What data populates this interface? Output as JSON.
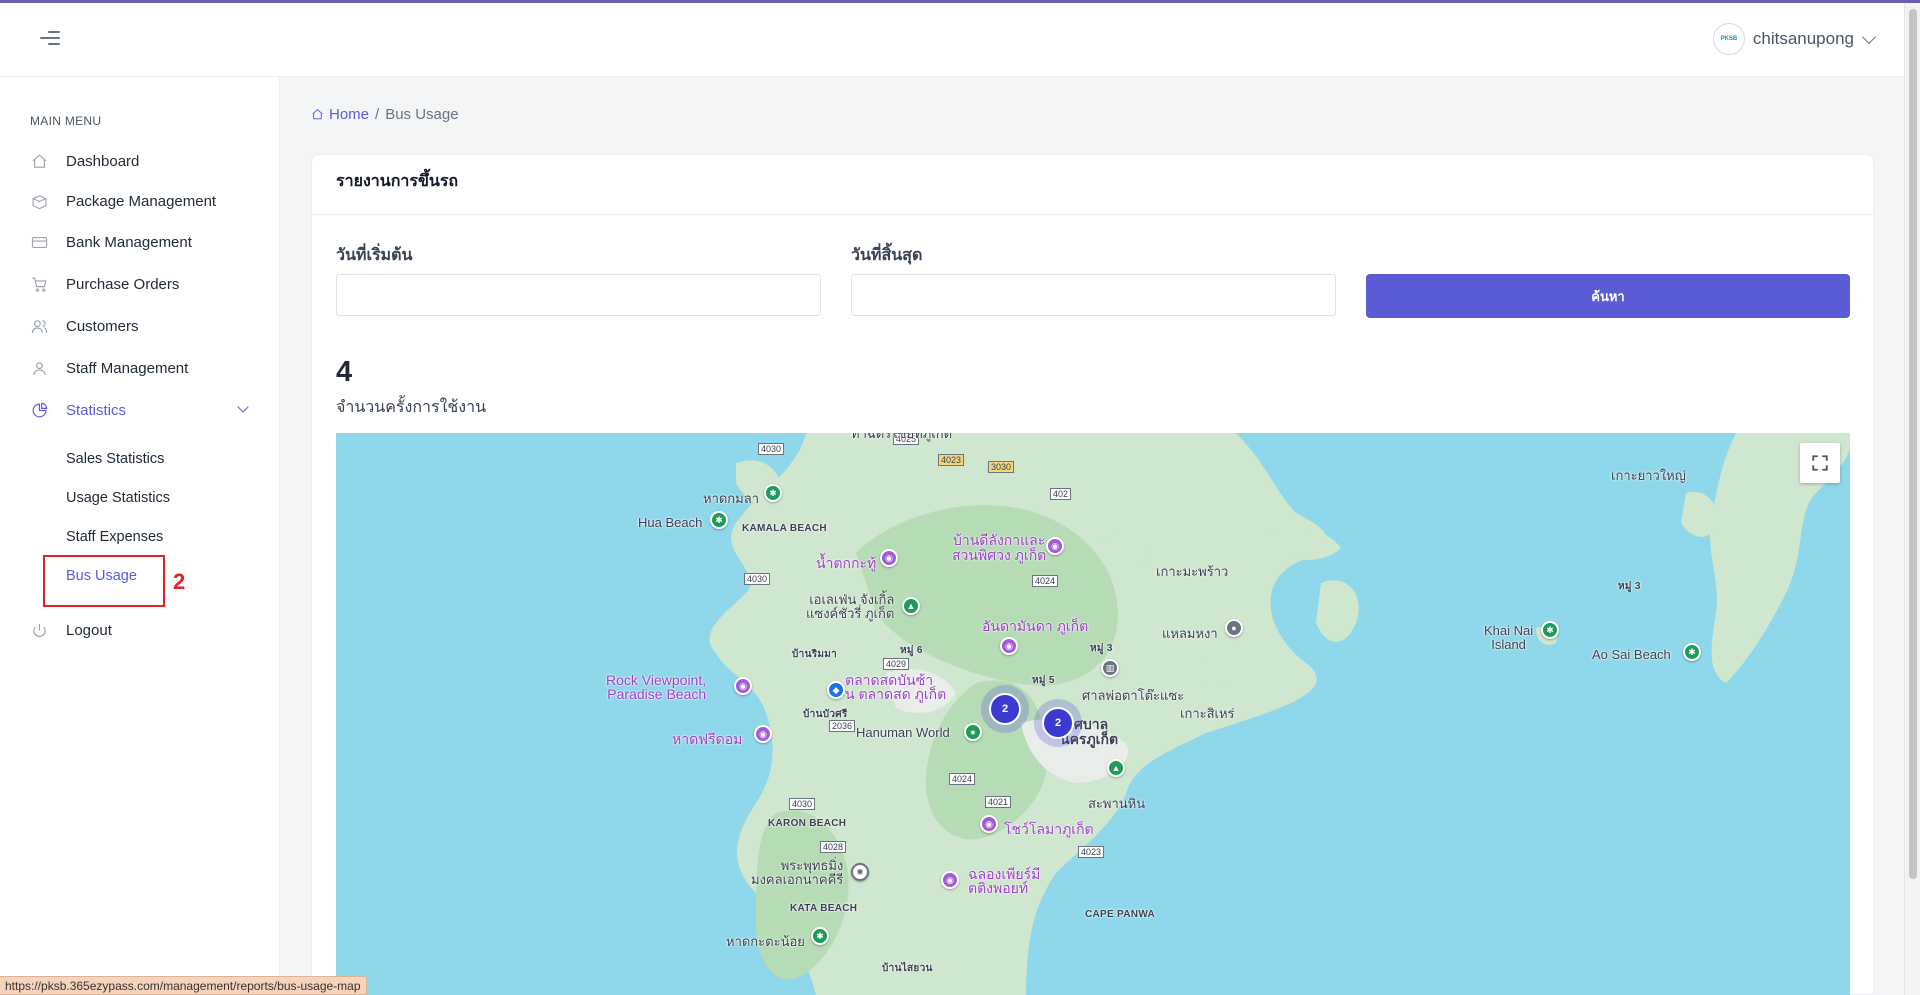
{
  "header": {
    "username": "chitsanupong",
    "avatar_text": "PKSB"
  },
  "sidebar": {
    "menu_title": "MAIN MENU",
    "items": [
      {
        "label": "Dashboard",
        "icon": "home-icon"
      },
      {
        "label": "Package Management",
        "icon": "package-icon"
      },
      {
        "label": "Bank Management",
        "icon": "credit-card-icon"
      },
      {
        "label": "Purchase Orders",
        "icon": "cart-icon"
      },
      {
        "label": "Customers",
        "icon": "users-icon"
      },
      {
        "label": "Staff Management",
        "icon": "user-icon"
      },
      {
        "label": "Statistics",
        "icon": "pie-chart-icon"
      },
      {
        "label": "Logout",
        "icon": "power-icon"
      }
    ],
    "sub_items": [
      "Sales Statistics",
      "Usage Statistics",
      "Staff Expenses",
      "Bus Usage"
    ]
  },
  "annotation": {
    "number": "2",
    "color": "#e02424"
  },
  "breadcrumb": {
    "home": "Home",
    "separator": "/",
    "current": "Bus Usage"
  },
  "card": {
    "title": "รายงานการขึ้นรถ",
    "start_label": "วันที่เริ่มต้น",
    "end_label": "วันที่สิ้นสุด",
    "search_button": "ค้นหา",
    "stat_value": "4",
    "stat_label": "จำนวนครั้งการใช้งาน"
  },
  "map": {
    "clusters": [
      "2",
      "2"
    ],
    "labels": {
      "hua_beach": "Hua Beach",
      "kamala_beach": "KAMALA BEACH",
      "hat_kamala": "หาดกมลา",
      "waterfall": "น้ำตกกะทู้",
      "elephant": "เอเลเฟ่น จังเกิ้ล\nแซงค์ชัวรี่ ภูเก็ต",
      "ban_thalang": "บ้านดีลังกาและ\nสวนพิศวง ภูเก็ต",
      "andamanda": "อันดามันดา ภูเก็ต",
      "ko_maphrao": "เกาะมะพร้าว",
      "laem_hin": "แหลมหงา",
      "ko_yao_yai": "เกาะยาวใหญ่",
      "khai_nai": "Khai Nai\nIsland",
      "ao_sai": "Ao Sai Beach",
      "rock_viewpoint": "Rock Viewpoint,\nParadise Beach",
      "market": "ตลาดสดบันซ้า\nน ตลาดสด ภูเก็ต",
      "ban_rimma": "บ้านริมมา",
      "ban_bua": "บ้านบัวศรี",
      "hat_freedom": "หาดฟรีดอม",
      "hanuman": "Hanuman World",
      "moo6": "หมู่ 6",
      "moo5": "หมู่ 5",
      "moo3": "หมู่ 3",
      "moo3b": "หมู่ 3",
      "shrine": "ศาลพ่อตาโต๊ะแซะ",
      "ko_sire": "เกาะสิเหร่",
      "city": "เทศบาล\nนครภูเก็ต",
      "saphan_hin": "สะพานหิน",
      "karon": "KARON BEACH",
      "big_buddha": "พระพุทธมิ่ง\nมงคลเอกนาคคีรี",
      "kata": "KATA BEACH",
      "kata_noi": "หาดกะตะน้อย",
      "show": "โชว์โลมาภูเก็ต",
      "chalong": "ฉลองเพียร์มี\nตติงพอยท์",
      "cape_panwa": "CAPE PANWA",
      "ban_saiyuan": "บ้านไสยวน",
      "top_label": "ท่าฉัตรไชยที่ภูเก็ต"
    },
    "roads": [
      "4030",
      "4025",
      "4023",
      "3030",
      "402",
      "4030",
      "4029",
      "2036",
      "4024",
      "4021",
      "4030",
      "4028",
      "4023",
      "4024"
    ]
  },
  "status_url": "https://pksb.365ezypass.com/management/reports/bus-usage-map"
}
